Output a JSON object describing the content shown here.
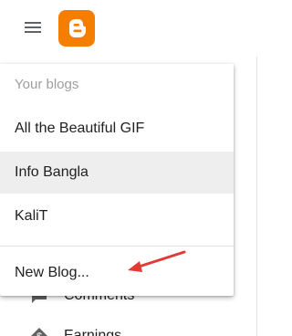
{
  "header": {
    "menu_icon": "hamburger-menu-icon",
    "logo_icon": "blogger-logo-icon",
    "logo_color": "#f57d00"
  },
  "sidebar": {
    "items": [
      {
        "label": "Comments",
        "icon": "comments-icon"
      },
      {
        "label": "Earnings",
        "icon": "earnings-icon"
      }
    ]
  },
  "blog_menu": {
    "header": "Your blogs",
    "blogs": [
      {
        "label": "All the Beautiful GIF",
        "selected": false
      },
      {
        "label": "Info Bangla",
        "selected": true
      },
      {
        "label": "KaliT",
        "selected": false
      }
    ],
    "new_blog_label": "New Blog...",
    "annotation_color": "#e53935"
  }
}
